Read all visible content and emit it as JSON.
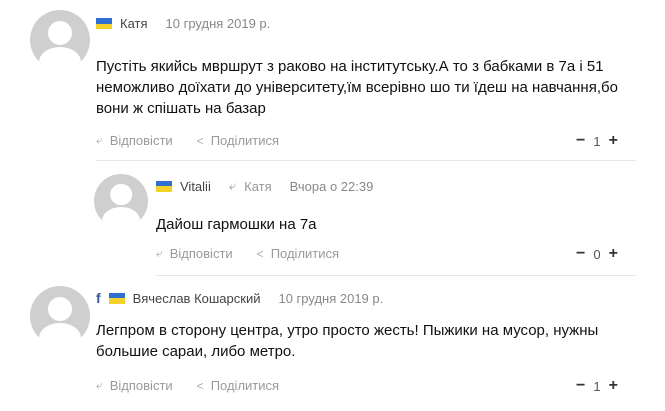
{
  "comments": [
    {
      "author": "Катя",
      "date": "10 грудня 2019 р.",
      "text": "Пустіть якийсь мвршрут з раково на інститутську.А то з бабками в 7а і 51 неможливо доїхати до університету,їм всерівно шо ти їдеш на навчання,бо вони ж спішать на базар",
      "reply_label": "Відповісти",
      "share_label": "Поділитися",
      "score": "1",
      "minus": "−",
      "plus": "+"
    },
    {
      "author": "Vitalii",
      "reply_to": "Катя",
      "date": "Вчора о 22:39",
      "text": "Дайош гармошки на 7а",
      "reply_label": "Відповісти",
      "share_label": "Поділитися",
      "score": "0",
      "minus": "−",
      "plus": "+"
    },
    {
      "author": "Вячеслав Кошарский",
      "social": "f",
      "date": "10 грудня 2019 р.",
      "text": "Легпром в сторону центра, утро просто жесть! Пыжики на мусор, нужны большие сараи, либо метро.",
      "reply_label": "Відповісти",
      "share_label": "Поділитися",
      "score": "1",
      "minus": "−",
      "plus": "+"
    }
  ],
  "icons": {
    "reply": "reply-arrow-icon",
    "share": "share-icon",
    "flag": "ukraine-flag-icon",
    "facebook": "facebook-icon"
  },
  "colors": {
    "flag_blue": "#2f6fd1",
    "flag_yellow": "#f4d22a",
    "facebook": "#3b5998"
  }
}
